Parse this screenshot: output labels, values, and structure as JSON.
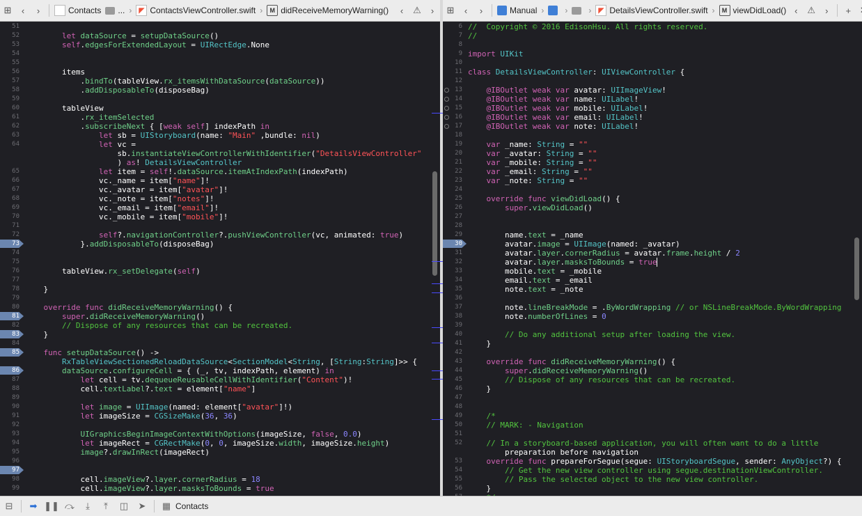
{
  "left_editor": {
    "jumpbar": {
      "project": "Contacts",
      "group": "...",
      "file": "ContactsViewController.swift",
      "method_badge": "M",
      "method": "didReceiveMemoryWarning()"
    },
    "lines": [
      {
        "n": "51",
        "t": ""
      },
      {
        "n": "52",
        "t": "        let dataSource = setupDataSource()"
      },
      {
        "n": "53",
        "t": "        self.edgesForExtendedLayout = UIRectEdge.None"
      },
      {
        "n": "54",
        "t": ""
      },
      {
        "n": "55",
        "t": ""
      },
      {
        "n": "56",
        "t": "        items"
      },
      {
        "n": "57",
        "t": "            .bindTo(tableView.rx_itemsWithDataSource(dataSource))"
      },
      {
        "n": "58",
        "t": "            .addDisposableTo(disposeBag)"
      },
      {
        "n": "59",
        "t": ""
      },
      {
        "n": "60",
        "t": "        tableView"
      },
      {
        "n": "61",
        "t": "            .rx_itemSelected"
      },
      {
        "n": "62",
        "t": "            .subscribeNext { [weak self] indexPath in"
      },
      {
        "n": "63",
        "t": "                let sb = UIStoryboard(name: \"Main\" ,bundle: nil)"
      },
      {
        "n": "64",
        "t": "                let vc ="
      },
      {
        "n": "",
        "t": "                    sb.instantiateViewControllerWithIdentifier(\"DetailsViewController\""
      },
      {
        "n": "",
        "t": "                    ) as! DetailsViewController"
      },
      {
        "n": "65",
        "t": "                let item = self!.dataSource.itemAtIndexPath(indexPath)"
      },
      {
        "n": "66",
        "t": "                vc._name = item[\"name\"]!"
      },
      {
        "n": "67",
        "t": "                vc._avatar = item[\"avatar\"]!"
      },
      {
        "n": "68",
        "t": "                vc._note = item[\"notes\"]!"
      },
      {
        "n": "69",
        "t": "                vc._email = item[\"email\"]!"
      },
      {
        "n": "70",
        "t": "                vc._mobile = item[\"mobile\"]!"
      },
      {
        "n": "71",
        "t": ""
      },
      {
        "n": "72",
        "t": "                self?.navigationController?.pushViewController(vc, animated: true)"
      },
      {
        "n": "73",
        "t": "            }.addDisposableTo(disposeBag)"
      },
      {
        "n": "74",
        "t": ""
      },
      {
        "n": "75",
        "t": ""
      },
      {
        "n": "76",
        "t": "        tableView.rx_setDelegate(self)"
      },
      {
        "n": "77",
        "t": ""
      },
      {
        "n": "78",
        "t": "    }"
      },
      {
        "n": "79",
        "t": ""
      },
      {
        "n": "80",
        "t": "    override func didReceiveMemoryWarning() {"
      },
      {
        "n": "81",
        "t": "        super.didReceiveMemoryWarning()"
      },
      {
        "n": "82",
        "t": "        // Dispose of any resources that can be recreated."
      },
      {
        "n": "83",
        "t": "    }"
      },
      {
        "n": "84",
        "t": ""
      },
      {
        "n": "85",
        "t": "    func setupDataSource() ->"
      },
      {
        "n": "",
        "t": "        RxTableViewSectionedReloadDataSource<SectionModel<String, [String:String]>> {"
      },
      {
        "n": "86",
        "t": "        dataSource.configureCell = { (_, tv, indexPath, element) in"
      },
      {
        "n": "87",
        "t": "            let cell = tv.dequeueReusableCellWithIdentifier(\"Content\")!"
      },
      {
        "n": "88",
        "t": "            cell.textLabel?.text = element[\"name\"]"
      },
      {
        "n": "89",
        "t": ""
      },
      {
        "n": "90",
        "t": "            let image = UIImage(named: element[\"avatar\"]!)"
      },
      {
        "n": "91",
        "t": "            let imageSize = CGSizeMake(36, 36)"
      },
      {
        "n": "92",
        "t": ""
      },
      {
        "n": "93",
        "t": "            UIGraphicsBeginImageContextWithOptions(imageSize, false, 0.0)"
      },
      {
        "n": "94",
        "t": "            let imageRect = CGRectMake(0, 0, imageSize.width, imageSize.height)"
      },
      {
        "n": "95",
        "t": "            image?.drawInRect(imageRect)"
      },
      {
        "n": "96",
        "t": ""
      },
      {
        "n": "97",
        "t": ""
      },
      {
        "n": "98",
        "t": "            cell.imageView?.layer.cornerRadius = 18"
      },
      {
        "n": "99",
        "t": "            cell.imageView?.layer.masksToBounds = true"
      }
    ]
  },
  "right_editor": {
    "jumpbar": {
      "group": "Manual",
      "file": "DetailsViewController.swift",
      "method_badge": "M",
      "method": "viewDidLoad()"
    },
    "lines": [
      {
        "n": "6",
        "t": "//  Copyright © 2016 EdisonHsu. All rights reserved."
      },
      {
        "n": "7",
        "t": "//"
      },
      {
        "n": "8",
        "t": ""
      },
      {
        "n": "9",
        "t": "import UIKit"
      },
      {
        "n": "10",
        "t": ""
      },
      {
        "n": "11",
        "t": "class DetailsViewController: UIViewController {"
      },
      {
        "n": "12",
        "t": ""
      },
      {
        "n": "13",
        "t": "    @IBOutlet weak var avatar: UIImageView!"
      },
      {
        "n": "14",
        "t": "    @IBOutlet weak var name: UILabel!"
      },
      {
        "n": "15",
        "t": "    @IBOutlet weak var mobile: UILabel!"
      },
      {
        "n": "16",
        "t": "    @IBOutlet weak var email: UILabel!"
      },
      {
        "n": "17",
        "t": "    @IBOutlet weak var note: UILabel!"
      },
      {
        "n": "18",
        "t": ""
      },
      {
        "n": "19",
        "t": "    var _name: String = \"\""
      },
      {
        "n": "20",
        "t": "    var _avatar: String = \"\""
      },
      {
        "n": "21",
        "t": "    var _mobile: String = \"\""
      },
      {
        "n": "22",
        "t": "    var _email: String = \"\""
      },
      {
        "n": "23",
        "t": "    var _note: String = \"\""
      },
      {
        "n": "24",
        "t": ""
      },
      {
        "n": "25",
        "t": "    override func viewDidLoad() {"
      },
      {
        "n": "26",
        "t": "        super.viewDidLoad()"
      },
      {
        "n": "27",
        "t": ""
      },
      {
        "n": "28",
        "t": ""
      },
      {
        "n": "29",
        "t": "        name.text = _name"
      },
      {
        "n": "30",
        "t": "        avatar.image = UIImage(named: _avatar)"
      },
      {
        "n": "31",
        "t": "        avatar.layer.cornerRadius = avatar.frame.height / 2"
      },
      {
        "n": "32",
        "t": "        avatar.layer.masksToBounds = true"
      },
      {
        "n": "33",
        "t": "        mobile.text = _mobile"
      },
      {
        "n": "34",
        "t": "        email.text = _email"
      },
      {
        "n": "35",
        "t": "        note.text = _note"
      },
      {
        "n": "36",
        "t": ""
      },
      {
        "n": "37",
        "t": "        note.lineBreakMode = .ByWordWrapping // or NSLineBreakMode.ByWordWrapping"
      },
      {
        "n": "38",
        "t": "        note.numberOfLines = 0"
      },
      {
        "n": "39",
        "t": ""
      },
      {
        "n": "40",
        "t": "        // Do any additional setup after loading the view."
      },
      {
        "n": "41",
        "t": "    }"
      },
      {
        "n": "42",
        "t": ""
      },
      {
        "n": "43",
        "t": "    override func didReceiveMemoryWarning() {"
      },
      {
        "n": "44",
        "t": "        super.didReceiveMemoryWarning()"
      },
      {
        "n": "45",
        "t": "        // Dispose of any resources that can be recreated."
      },
      {
        "n": "46",
        "t": "    }"
      },
      {
        "n": "47",
        "t": ""
      },
      {
        "n": "48",
        "t": ""
      },
      {
        "n": "49",
        "t": "    /*"
      },
      {
        "n": "50",
        "t": "    // MARK: - Navigation"
      },
      {
        "n": "51",
        "t": ""
      },
      {
        "n": "52",
        "t": "    // In a storyboard-based application, you will often want to do a little"
      },
      {
        "n": "",
        "t": "        preparation before navigation"
      },
      {
        "n": "53",
        "t": "    override func prepareForSegue(segue: UIStoryboardSegue, sender: AnyObject?) {"
      },
      {
        "n": "54",
        "t": "        // Get the new view controller using segue.destinationViewController."
      },
      {
        "n": "55",
        "t": "        // Pass the selected object to the new view controller."
      },
      {
        "n": "56",
        "t": "    }"
      },
      {
        "n": "57",
        "t": "    */"
      }
    ]
  },
  "bottom_bar": {
    "target": "Contacts"
  },
  "colors": {
    "background": "#1f1f24",
    "keyword": "#d163b5",
    "type": "#54c4c7",
    "function": "#6fd089",
    "string": "#ff5357",
    "comment": "#52c43f",
    "number": "#8b86ff",
    "breakpoint": "#6b86b0"
  }
}
